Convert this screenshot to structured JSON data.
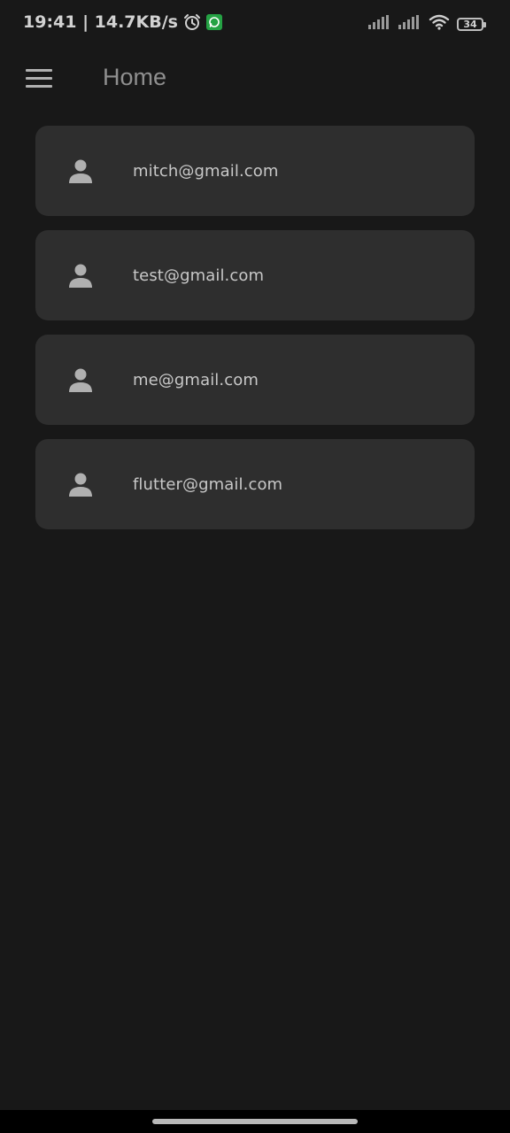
{
  "status_bar": {
    "time_speed": "19:41 | 14.7KB/s",
    "battery": "34",
    "icons": [
      "alarm-icon",
      "whatsapp-icon",
      "signal-icon",
      "signal-icon",
      "wifi-icon",
      "battery-icon"
    ]
  },
  "app_bar": {
    "title": "Home",
    "menu_icon": "hamburger-menu-icon"
  },
  "users": [
    {
      "email": "mitch@gmail.com",
      "icon": "person-icon"
    },
    {
      "email": "test@gmail.com",
      "icon": "person-icon"
    },
    {
      "email": "me@gmail.com",
      "icon": "person-icon"
    },
    {
      "email": "flutter@gmail.com",
      "icon": "person-icon"
    }
  ],
  "colors": {
    "background": "#181818",
    "tile": "#2e2e2e",
    "text": "#c8c8c8",
    "title": "#8f8f8f",
    "whatsapp": "#25a244"
  }
}
